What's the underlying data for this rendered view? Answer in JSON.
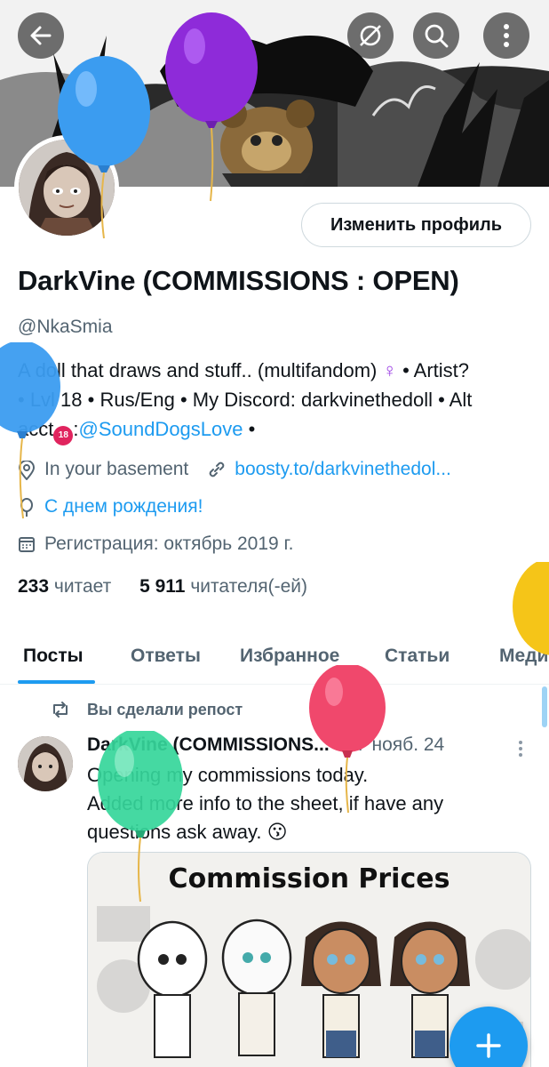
{
  "header": {
    "back_icon": "arrow-left-icon",
    "no_location_icon": "crossed-circle-icon",
    "search_icon": "search-icon",
    "more_icon": "more-vertical-icon"
  },
  "profile": {
    "edit_button": "Изменить профиль",
    "display_name": "DarkVine (COMMISSIONS : OPEN)",
    "handle": "@NkaSmia",
    "bio": {
      "line1": "A doll that draws and stuff.. (multifandom) ",
      "symbol": "♀",
      "line1_end": " • Artist?",
      "line2": "• Lvl 18 • Rus/Eng  • My Discord: darkvinethedoll • Alt",
      "line3_start": "acct",
      "age_badge": "18",
      "line3_mid": ":",
      "mention": "@SoundDogsLove",
      "line3_end": " •"
    },
    "location": "In your basement",
    "website": "boosty.to/darkvinethedol...",
    "birthday": "С днем рождения!",
    "joined": "Регистрация: октябрь 2019 г.",
    "following_count": "233",
    "following_label": "читает",
    "followers_count": "5 911",
    "followers_label": "читателя(-ей)"
  },
  "tabs": [
    {
      "label": "Посты"
    },
    {
      "label": "Ответы"
    },
    {
      "label": "Избранное"
    },
    {
      "label": "Статьи"
    },
    {
      "label": "Меди"
    }
  ],
  "post": {
    "repost_label": "Вы сделали репост",
    "author": "DarkVine (COMMISSIONS...",
    "date": " · 07 нояб. 24",
    "text_line1": "Opening my commissions today.",
    "text_line2": "Added more info to the sheet, if have any",
    "text_line3": "questions ask away. 😗",
    "image_title": "Commission Prices"
  },
  "colors": {
    "accent": "#1d9bf0",
    "text": "#0f1419",
    "secondary": "#536471",
    "balloon_blue": "#3b9cf0",
    "balloon_purple": "#8e2bd9",
    "balloon_yellow": "#f5c518",
    "balloon_red": "#f0486c",
    "balloon_green": "#35d69a"
  }
}
